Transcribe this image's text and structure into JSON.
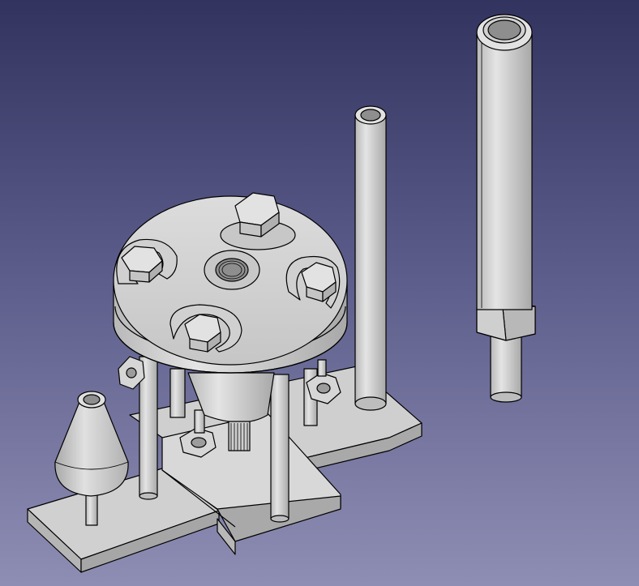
{
  "view": {
    "background_top": "#33335f",
    "background_bottom": "#8e8eb4",
    "part_fill": "#d2d2d2",
    "part_light": "#e6e6e6",
    "part_shade": "#b4b4b4",
    "edge_color": "#000000"
  },
  "objects": [
    "base-plate",
    "press-housing",
    "hex-bolt",
    "clamp-washer",
    "threaded-hole",
    "support-post",
    "hex-nut",
    "tall-tube",
    "large-tube",
    "conical-part"
  ]
}
